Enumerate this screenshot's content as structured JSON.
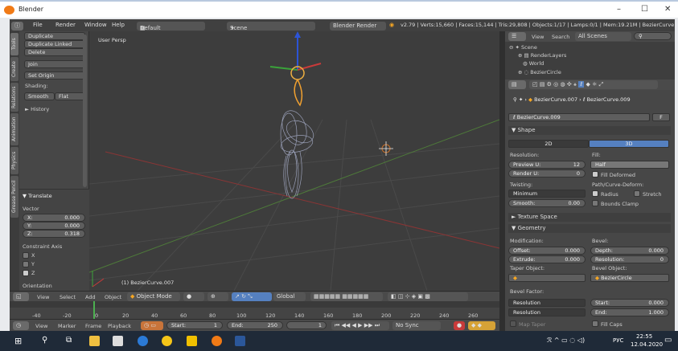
{
  "window": {
    "title": "Blender",
    "minimize": "–",
    "maximize": "☐",
    "close": "✕"
  },
  "menubar": {
    "menus": [
      "File",
      "Render",
      "Window",
      "Help"
    ],
    "layout": "Default",
    "scene": "Scene",
    "engine": "Blender Render",
    "stats": "v2.79 | Verts:15,660 | Faces:15,144 | Tris:29,808 | Objects:1/17 | Lamps:0/1 | Mem:19.21M | BezierCurve"
  },
  "toolshelf": {
    "tabs": [
      "Tools",
      "Create",
      "Relations",
      "Animation",
      "Physics",
      "Grease Pencil"
    ],
    "buttons": [
      "Duplicate",
      "Duplicate Linked",
      "Delete",
      "Join",
      "Set Origin"
    ],
    "shading_label": "Shading:",
    "smooth": "Smooth",
    "flat": "Flat",
    "history": "► History"
  },
  "operator": {
    "title": "▼ Translate",
    "vector_label": "Vector",
    "x": "X:",
    "x_val": "0.000",
    "y": "Y:",
    "y_val": "0.000",
    "z": "Z:",
    "z_val": "0.318",
    "constraint_label": "Constraint Axis",
    "axes": [
      "X",
      "Y",
      "Z"
    ],
    "orientation": "Orientation"
  },
  "viewport": {
    "label": "User Persp",
    "object": "(1) BezierCurve.007"
  },
  "view3d_header": {
    "view": "View",
    "select": "Select",
    "add": "Add",
    "object": "Object",
    "mode": "Object Mode",
    "orientation": "Global"
  },
  "timeline": {
    "ticks": [
      "-40",
      "-20",
      "0",
      "20",
      "40",
      "60",
      "80",
      "100",
      "120",
      "140",
      "160",
      "180",
      "200",
      "220",
      "240",
      "260"
    ]
  },
  "timeline_header": {
    "view": "View",
    "marker": "Marker",
    "frame": "Frame",
    "playback": "Playback",
    "start": "Start:",
    "start_val": "1",
    "end": "End:",
    "end_val": "250",
    "current": "1",
    "sync": "No Sync"
  },
  "outliner": {
    "view": "View",
    "search": "Search",
    "scenes": "All Scenes",
    "items": [
      "Scene",
      "RenderLayers",
      "World",
      "BezierCircle"
    ]
  },
  "properties": {
    "breadcrumb_obj": "BezierCurve.007",
    "breadcrumb_data": "BezierCurve.009",
    "datablock": "BezierCurve.009",
    "f_button": "F",
    "shape": "▼ Shape",
    "tab2d": "2D",
    "tab3d": "3D",
    "resolution": "Resolution:",
    "preview_u": "Preview U:",
    "preview_u_val": "12",
    "render_u": "Render U:",
    "render_u_val": "0",
    "fill": "Fill:",
    "fill_val": "Half",
    "fill_deformed": "Fill Deformed",
    "twisting": "Twisting:",
    "twisting_val": "Minimum",
    "smooth": "Smooth:",
    "smooth_val": "0.00",
    "path_deform": "Path/Curve-Deform:",
    "radius": "Radius",
    "stretch": "Stretch",
    "bounds_clamp": "Bounds Clamp",
    "texture_space": "► Texture Space",
    "geometry": "▼ Geometry",
    "modification": "Modification:",
    "offset": "Offset:",
    "offset_val": "0.000",
    "extrude": "Extrude:",
    "extrude_val": "0.000",
    "taper": "Taper Object:",
    "bevel": "Bevel:",
    "depth": "Depth:",
    "depth_val": "0.000",
    "bres": "Resolution:",
    "bres_val": "0",
    "bevel_obj": "Bevel Object:",
    "bevel_obj_val": "BezierCircle",
    "bevel_factor": "Bevel Factor:",
    "bf_res1": "Resolution",
    "bf_res2": "Resolution",
    "bf_start": "Start:",
    "bf_start_val": "0.000",
    "bf_end": "End:",
    "bf_end_val": "1.000",
    "map_taper": "Map Taper",
    "fill_caps": "Fill Caps"
  },
  "taskbar": {
    "time": "22:55",
    "date": "12.04.2020",
    "lang": "РУС"
  }
}
